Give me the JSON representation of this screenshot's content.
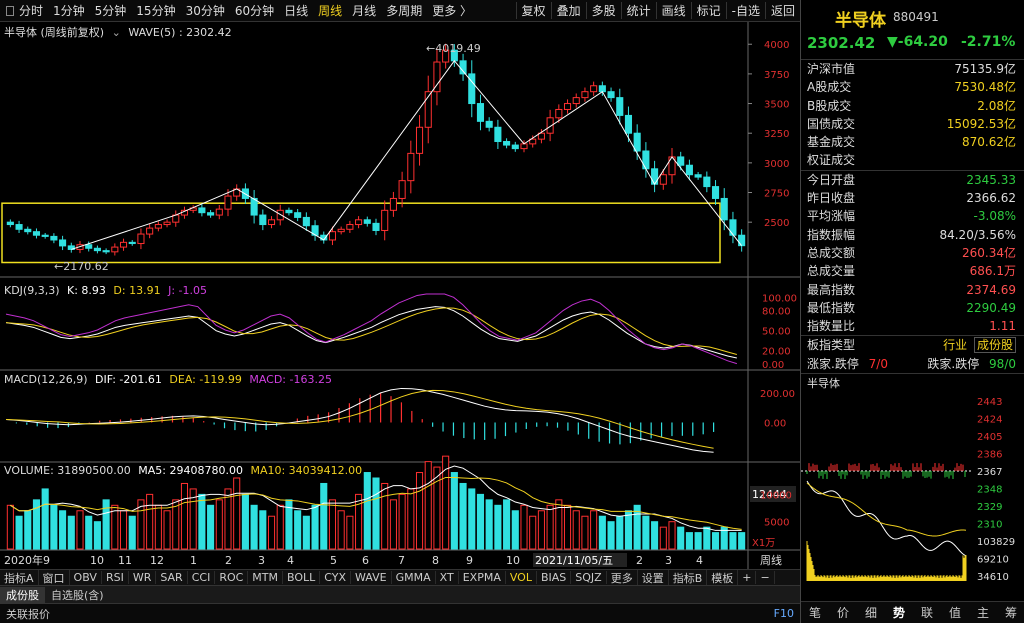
{
  "toolbar": {
    "periods": [
      "分时",
      "1分钟",
      "5分钟",
      "15分钟",
      "30分钟",
      "60分钟",
      "日线",
      "周线",
      "月线",
      "多周期",
      "更多 〉"
    ],
    "right": [
      "复权",
      "叠加",
      "多股",
      "统计",
      "画线",
      "标记",
      "-自选",
      "返回"
    ]
  },
  "kline": {
    "title": "半导体 (周线前复权)",
    "wave": "WAVE(5) : 2302.42",
    "hi_label": "4019.49",
    "lo_label": "2170.62",
    "yticks": [
      2500,
      2750,
      3000,
      3250,
      3500,
      3750,
      4000
    ],
    "range": [
      2080,
      4120
    ],
    "box": [
      2160,
      2660
    ]
  },
  "kdj": {
    "title": "KDJ(9,3,3)",
    "k": "K: 8.93",
    "d": "D: 13.91",
    "j": "J: -1.05",
    "yticks": [
      "100.00",
      "80.00",
      "50.00",
      "20.00",
      "0.00"
    ]
  },
  "macd": {
    "title": "MACD(12,26,9)",
    "dif": "DIF: -201.61",
    "dea": "DEA: -119.99",
    "macd": "MACD: -163.25",
    "yticks": [
      "200.00",
      "0.00"
    ]
  },
  "volume": {
    "title": "VOLUME: 31890500.00",
    "ma5": "MA5: 29408780.00",
    "ma10": "MA10: 34039412.00",
    "ylabels": [
      "12444",
      "10000",
      "5000",
      "X1万"
    ]
  },
  "xaxis": {
    "labels": [
      "2020年9",
      "10",
      "11",
      "12",
      "1",
      "2",
      "3",
      "4",
      "5",
      "6",
      "7",
      "8",
      "9",
      "10",
      "2021/11/05/五",
      "2",
      "3",
      "4"
    ],
    "period": "周线"
  },
  "bottom_tabs": [
    "指标A",
    "窗口",
    "OBV",
    "RSI",
    "WR",
    "SAR",
    "CCI",
    "ROC",
    "MTM",
    "BOLL",
    "CYX",
    "WAVE",
    "GMMA",
    "XT",
    "EXPMA",
    "VOL",
    "BIAS",
    "SQJZ",
    "更多",
    "设置",
    "指标B",
    "模板",
    "+",
    "−"
  ],
  "bottom_sel": "VOL",
  "row2": [
    "成份股",
    "自选股(含)"
  ],
  "row3": [
    "关联报价",
    "F10"
  ],
  "chart_data": [
    {
      "type": "candlestick",
      "title": "半导体 (周线前复权)",
      "closes": [
        2480,
        2440,
        2420,
        2390,
        2380,
        2350,
        2300,
        2270,
        2310,
        2280,
        2260,
        2250,
        2290,
        2330,
        2320,
        2400,
        2450,
        2480,
        2500,
        2560,
        2600,
        2620,
        2580,
        2560,
        2610,
        2720,
        2780,
        2700,
        2560,
        2480,
        2520,
        2600,
        2580,
        2540,
        2470,
        2390,
        2350,
        2420,
        2440,
        2480,
        2520,
        2490,
        2430,
        2600,
        2700,
        2850,
        3080,
        3300,
        3600,
        3850,
        3950,
        3860,
        3750,
        3500,
        3350,
        3300,
        3180,
        3150,
        3120,
        3160,
        3200,
        3250,
        3380,
        3450,
        3500,
        3550,
        3600,
        3650,
        3600,
        3550,
        3400,
        3250,
        3100,
        2950,
        2820,
        2900,
        3050,
        2980,
        2900,
        2880,
        2800,
        2700,
        2520,
        2390,
        2302
      ],
      "ylim": [
        2080,
        4120
      ]
    },
    {
      "type": "line",
      "title": "KDJ(9,3,3)",
      "K": [
        62,
        60,
        58,
        55,
        50,
        45,
        40,
        38,
        40,
        42,
        45,
        50,
        55,
        58,
        60,
        62,
        64,
        66,
        68,
        70,
        72,
        70,
        60,
        50,
        45,
        42,
        45,
        50,
        55,
        60,
        62,
        58,
        50,
        42,
        35,
        32,
        36,
        40,
        45,
        50,
        55,
        62,
        68,
        74,
        78,
        82,
        84,
        86,
        85,
        80,
        72,
        62,
        52,
        44,
        38,
        36,
        34,
        38,
        42,
        50,
        58,
        66,
        72,
        76,
        78,
        74,
        66,
        56,
        46,
        38,
        30,
        26,
        24,
        26,
        30,
        28,
        24,
        20,
        16,
        12,
        9
      ],
      "ylim": [
        0,
        105
      ]
    },
    {
      "type": "bar",
      "title": "MACD(12,26,9)",
      "DIF": [
        20,
        15,
        8,
        0,
        -8,
        -12,
        -15,
        -12,
        -8,
        -5,
        -2,
        2,
        8,
        15,
        22,
        30,
        38,
        42,
        45,
        40,
        32,
        20,
        10,
        0,
        -10,
        -15,
        -12,
        -5,
        5,
        15,
        25,
        40,
        65,
        95,
        130,
        165,
        200,
        220,
        230,
        228,
        220,
        205,
        190,
        170,
        150,
        130,
        110,
        95,
        85,
        80,
        78,
        75,
        70,
        60,
        45,
        25,
        0,
        -25,
        -50,
        -75,
        -95,
        -110,
        -125,
        -140,
        -155,
        -170,
        -185,
        -195,
        -201
      ],
      "ylim": [
        -240,
        260
      ]
    },
    {
      "type": "bar",
      "title": "VOLUME",
      "values": [
        8,
        6,
        7,
        9,
        11,
        8,
        7,
        6,
        7,
        6,
        5,
        9,
        8,
        7,
        6,
        9,
        10,
        8,
        7,
        9,
        12,
        11,
        10,
        8,
        9,
        11,
        13,
        10,
        8,
        7,
        6,
        8,
        9,
        7,
        6,
        8,
        12,
        9,
        7,
        6,
        10,
        14,
        13,
        12,
        9,
        10,
        11,
        14,
        16,
        15,
        17,
        14,
        12,
        11,
        10,
        9,
        8,
        9,
        7,
        8,
        6,
        7,
        8,
        9,
        8,
        7,
        6,
        7,
        6,
        5,
        6,
        7,
        8,
        6,
        5,
        4,
        5,
        4,
        3,
        3,
        4,
        3,
        4,
        3,
        3
      ],
      "ylim": [
        0,
        13
      ]
    }
  ],
  "side": {
    "name": "半导体",
    "code": "880491",
    "price": "2302.42",
    "change": "▼-64.20",
    "pct": "-2.71%",
    "rows1": [
      [
        "沪深市值",
        "75135.9亿"
      ],
      [
        "A股成交",
        "7530.48亿"
      ],
      [
        "B股成交",
        "2.08亿"
      ],
      [
        "国债成交",
        "15092.53亿"
      ],
      [
        "基金成交",
        "870.62亿"
      ],
      [
        "权证成交",
        ""
      ]
    ],
    "rows2": [
      [
        "今日开盘",
        "2345.33"
      ],
      [
        "昨日收盘",
        "2366.62"
      ],
      [
        "平均涨幅",
        "-3.08%"
      ],
      [
        "指数振幅",
        "84.20/3.56%"
      ],
      [
        "总成交额",
        "260.34亿"
      ],
      [
        "总成交量",
        "686.1万"
      ],
      [
        "最高指数",
        "2374.69"
      ],
      [
        "最低指数",
        "2290.49"
      ],
      [
        "指数量比",
        "1.11"
      ]
    ],
    "board": [
      "板指类型",
      "行业",
      "成份股"
    ],
    "updown": [
      "涨家.跌停",
      "7/0",
      "跌家.跌停",
      "98/0"
    ],
    "mini_title": "半导体",
    "mini_yticks": [
      "2443",
      "2424",
      "2405",
      "2386",
      "2367",
      "2348",
      "2329",
      "2310",
      "103829",
      "69210",
      "34610"
    ],
    "tabs": [
      "笔",
      "价",
      "细",
      "势",
      "联",
      "值",
      "主",
      "筹"
    ],
    "tab_sel": "势",
    "colors": {
      "up": "#ff3030",
      "down": "#30e0e0",
      "accent": "#f0d020",
      "green": "#2ecc40"
    }
  }
}
